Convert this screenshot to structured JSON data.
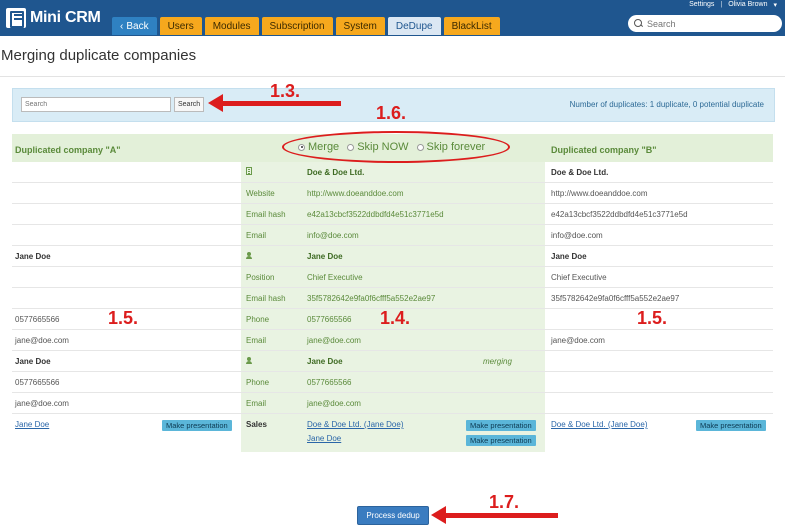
{
  "header": {
    "logo_text": "Mini CRM",
    "user_links": [
      "Settings",
      "|",
      "Olivia Brown"
    ],
    "user_menu_arrow": "▾",
    "search_placeholder": "Search",
    "tabs": [
      {
        "label": "Back",
        "style": "back"
      },
      {
        "label": "Users",
        "style": "orange"
      },
      {
        "label": "Modules",
        "style": "orange"
      },
      {
        "label": "Subscription",
        "style": "orange"
      },
      {
        "label": "System",
        "style": "orange"
      },
      {
        "label": "DeDupe",
        "style": "active"
      },
      {
        "label": "BlackList",
        "style": "orange"
      }
    ],
    "back_chevron": "‹"
  },
  "page": {
    "title": "Merging duplicate companies"
  },
  "search": {
    "placeholder": "Search",
    "button_label": "Search",
    "dup_count": "Number of duplicates: 1 duplicate, 0 potential duplicate"
  },
  "table": {
    "header_a": "Duplicated company \"A\"",
    "header_b": "Duplicated company \"B\"",
    "options": [
      {
        "label": "Merge",
        "selected": true
      },
      {
        "label": "Skip NOW",
        "selected": false
      },
      {
        "label": "Skip forever",
        "selected": false
      }
    ],
    "rows": [
      {
        "a": "",
        "label": "",
        "value": "Doe & Doe Ltd.",
        "b": "Doe & Doe Ltd.",
        "icon": "building-icon"
      },
      {
        "a": "",
        "label": "Website",
        "value": "http://www.doeanddoe.com",
        "b": "http://www.doeanddoe.com"
      },
      {
        "a": "",
        "label": "Email hash",
        "value": "e42a13cbcf3522ddbdfd4e51c3771e5d",
        "b": "e42a13cbcf3522ddbdfd4e51c3771e5d"
      },
      {
        "a": "",
        "label": "Email",
        "value": "info@doe.com",
        "b": "info@doe.com"
      },
      {
        "a": "Jane Doe",
        "label": "",
        "value": "Jane Doe",
        "b": "Jane Doe",
        "icon": "person-icon"
      },
      {
        "a": "",
        "label": "Position",
        "value": "Chief Executive",
        "b": "Chief Executive"
      },
      {
        "a": "",
        "label": "Email hash",
        "value": "35f5782642e9fa0f6cfff5a552e2ae97",
        "b": "35f5782642e9fa0f6cfff5a552e2ae97"
      },
      {
        "a": "0577665566",
        "label": "Phone",
        "value": "0577665566",
        "b": ""
      },
      {
        "a": "jane@doe.com",
        "label": "Email",
        "value": "jane@doe.com",
        "b": "jane@doe.com"
      },
      {
        "a": "Jane Doe",
        "label": "",
        "value": "Jane Doe",
        "b": "",
        "icon": "person-icon",
        "note": "merging"
      },
      {
        "a": "0577665566",
        "label": "Phone",
        "value": "0577665566",
        "b": ""
      },
      {
        "a": "jane@doe.com",
        "label": "Email",
        "value": "jane@doe.com",
        "b": ""
      }
    ],
    "sales": {
      "a_link": "Jane Doe",
      "label": "Sales",
      "mid_links": [
        "Doe & Doe Ltd. (Jane Doe)",
        "Jane Doe"
      ],
      "b_link": "Doe & Doe Ltd. (Jane Doe)",
      "button_label": "Make presentation"
    }
  },
  "annotations": {
    "a13": "1.3.",
    "a16": "1.6.",
    "a15_left": "1.5.",
    "a14": "1.4.",
    "a15_right": "1.5.",
    "a17": "1.7."
  },
  "actions": {
    "process_label": "Process dedup"
  },
  "colors": {
    "topbar": "#1f568f",
    "orange_tab": "#f6a81d",
    "annotation_red": "#dc1d1d",
    "green_text": "#5a8a3a"
  }
}
